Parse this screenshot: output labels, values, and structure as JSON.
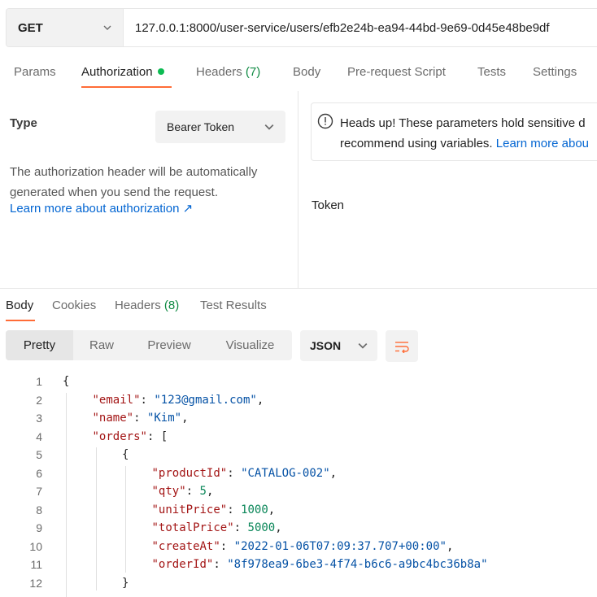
{
  "request": {
    "method": "GET",
    "url": "127.0.0.1:8000/user-service/users/efb2e24b-ea94-44bd-9e69-0d45e48be9df"
  },
  "request_tabs": {
    "params": "Params",
    "authorization": "Authorization",
    "headers": "Headers",
    "headers_count": "(7)",
    "body": "Body",
    "pre_request": "Pre-request Script",
    "tests": "Tests",
    "settings": "Settings"
  },
  "auth": {
    "type_label": "Type",
    "type_value": "Bearer Token",
    "description_line1": "The authorization header will be automatically",
    "description_line2": "generated when you send the request.",
    "learn_more": "Learn more about authorization ↗",
    "alert_line1": "Heads up! These parameters hold sensitive d",
    "alert_line2": "recommend using variables. ",
    "alert_link": "Learn more abou",
    "token_label": "Token"
  },
  "response_tabs": {
    "body": "Body",
    "cookies": "Cookies",
    "headers": "Headers",
    "headers_count": "(8)",
    "test_results": "Test Results"
  },
  "toolbar": {
    "pretty": "Pretty",
    "raw": "Raw",
    "preview": "Preview",
    "visualize": "Visualize",
    "format": "JSON"
  },
  "code_lines": [
    {
      "n": "1",
      "indent": 0,
      "tokens": [
        {
          "t": "p",
          "v": "{"
        }
      ]
    },
    {
      "n": "2",
      "indent": 1,
      "tokens": [
        {
          "t": "k",
          "v": "\"email\""
        },
        {
          "t": "p",
          "v": ": "
        },
        {
          "t": "s",
          "v": "\"123@gmail.com\""
        },
        {
          "t": "p",
          "v": ","
        }
      ]
    },
    {
      "n": "3",
      "indent": 1,
      "tokens": [
        {
          "t": "k",
          "v": "\"name\""
        },
        {
          "t": "p",
          "v": ": "
        },
        {
          "t": "s",
          "v": "\"Kim\""
        },
        {
          "t": "p",
          "v": ","
        }
      ]
    },
    {
      "n": "4",
      "indent": 1,
      "tokens": [
        {
          "t": "k",
          "v": "\"orders\""
        },
        {
          "t": "p",
          "v": ": ["
        }
      ]
    },
    {
      "n": "5",
      "indent": 2,
      "tokens": [
        {
          "t": "p",
          "v": "{"
        }
      ]
    },
    {
      "n": "6",
      "indent": 3,
      "tokens": [
        {
          "t": "k",
          "v": "\"productId\""
        },
        {
          "t": "p",
          "v": ": "
        },
        {
          "t": "s",
          "v": "\"CATALOG-002\""
        },
        {
          "t": "p",
          "v": ","
        }
      ]
    },
    {
      "n": "7",
      "indent": 3,
      "tokens": [
        {
          "t": "k",
          "v": "\"qty\""
        },
        {
          "t": "p",
          "v": ": "
        },
        {
          "t": "n",
          "v": "5"
        },
        {
          "t": "p",
          "v": ","
        }
      ]
    },
    {
      "n": "8",
      "indent": 3,
      "tokens": [
        {
          "t": "k",
          "v": "\"unitPrice\""
        },
        {
          "t": "p",
          "v": ": "
        },
        {
          "t": "n",
          "v": "1000"
        },
        {
          "t": "p",
          "v": ","
        }
      ]
    },
    {
      "n": "9",
      "indent": 3,
      "tokens": [
        {
          "t": "k",
          "v": "\"totalPrice\""
        },
        {
          "t": "p",
          "v": ": "
        },
        {
          "t": "n",
          "v": "5000"
        },
        {
          "t": "p",
          "v": ","
        }
      ]
    },
    {
      "n": "10",
      "indent": 3,
      "tokens": [
        {
          "t": "k",
          "v": "\"createAt\""
        },
        {
          "t": "p",
          "v": ": "
        },
        {
          "t": "s",
          "v": "\"2022-01-06T07:09:37.707+00:00\""
        },
        {
          "t": "p",
          "v": ","
        }
      ]
    },
    {
      "n": "11",
      "indent": 3,
      "tokens": [
        {
          "t": "k",
          "v": "\"orderId\""
        },
        {
          "t": "p",
          "v": ": "
        },
        {
          "t": "s",
          "v": "\"8f978ea9-6be3-4f74-b6c6-a9bc4bc36b8a\""
        }
      ]
    },
    {
      "n": "12",
      "indent": 2,
      "tokens": [
        {
          "t": "p",
          "v": "}"
        }
      ]
    }
  ],
  "colors": {
    "accent": "#ff6c37",
    "link": "#0265d2",
    "success": "#0cbb52",
    "json_key": "#a31515",
    "json_string": "#0451a5",
    "json_number": "#098658"
  }
}
